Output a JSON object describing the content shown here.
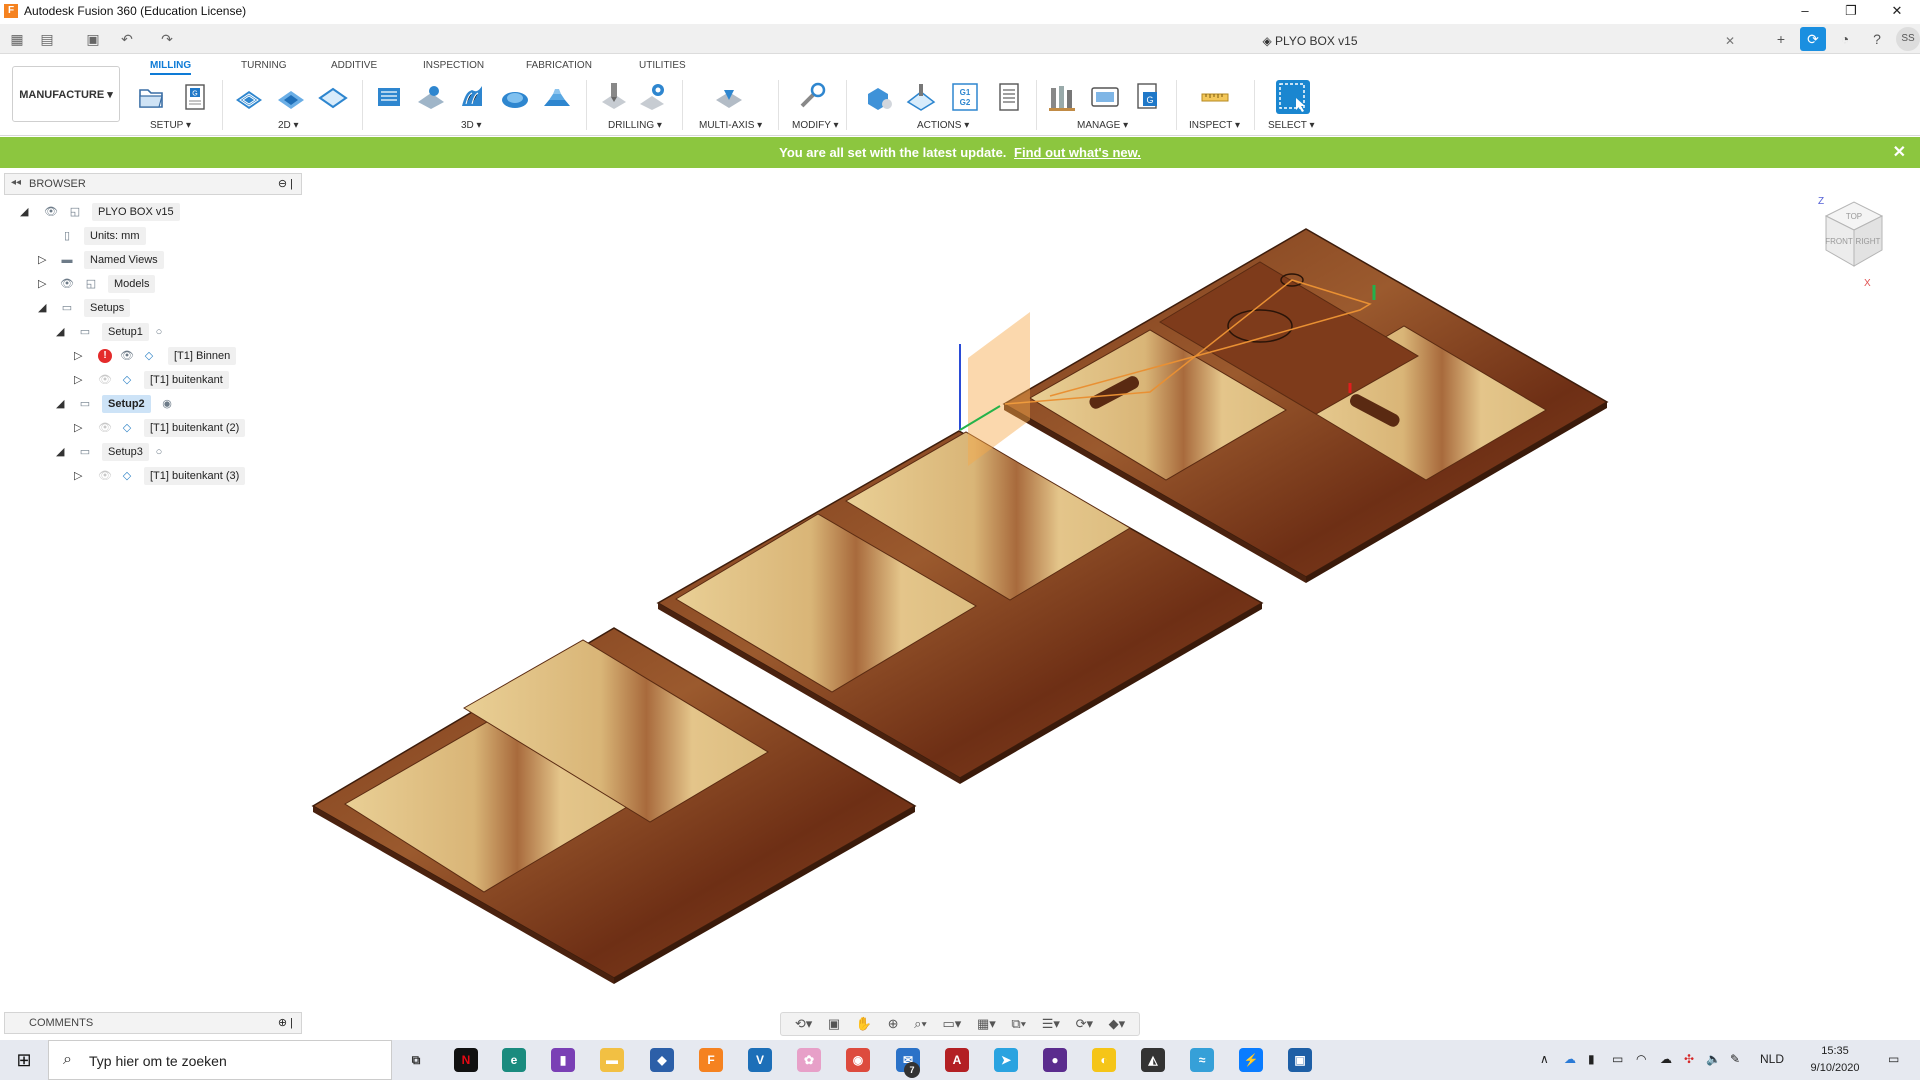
{
  "window": {
    "title": "Autodesk Fusion 360 (Education License)",
    "controls": [
      "–",
      "❐",
      "✕"
    ]
  },
  "document": {
    "tab_title": "PLYO BOX v15",
    "user_initials": "SS"
  },
  "ribbon": {
    "workspace": "MANUFACTURE ▾",
    "tabs": [
      "MILLING",
      "TURNING",
      "ADDITIVE",
      "INSPECTION",
      "FABRICATION",
      "UTILITIES"
    ],
    "active_tab": "MILLING",
    "groups": [
      "SETUP ▾",
      "2D ▾",
      "3D ▾",
      "DRILLING ▾",
      "MULTI-AXIS ▾",
      "MODIFY ▾",
      "ACTIONS ▾",
      "MANAGE ▾",
      "INSPECT ▾",
      "SELECT ▾"
    ],
    "actions_g1g2": "G1\nG2",
    "accent": "#0e7bd6"
  },
  "banner": {
    "text": "You are all set with the latest update.",
    "link": "Find out what's new.",
    "close": "✕",
    "color": "#8cc63f"
  },
  "browser": {
    "title": "BROWSER",
    "rows": [
      {
        "label": "PLYO BOX v15"
      },
      {
        "label": "Units: mm"
      },
      {
        "label": "Named Views"
      },
      {
        "label": "Models"
      },
      {
        "label": "Setups"
      },
      {
        "label": "Setup1"
      },
      {
        "label": "[T1] Binnen",
        "error": "!"
      },
      {
        "label": "[T1] buitenkant"
      },
      {
        "label": "Setup2"
      },
      {
        "label": "[T1] buitenkant (2)"
      },
      {
        "label": "Setup3"
      },
      {
        "label": "[T1] buitenkant (3)"
      }
    ]
  },
  "comments": {
    "title": "COMMENTS"
  },
  "viewcube": {
    "top": "TOP",
    "front": "FRONT",
    "right": "RIGHT",
    "z": "Z",
    "x": "X"
  },
  "taskbar": {
    "search_placeholder": "Typ hier om te zoeken",
    "language": "NLD",
    "time": "15:35",
    "date": "9/10/2020",
    "badge": "7"
  }
}
